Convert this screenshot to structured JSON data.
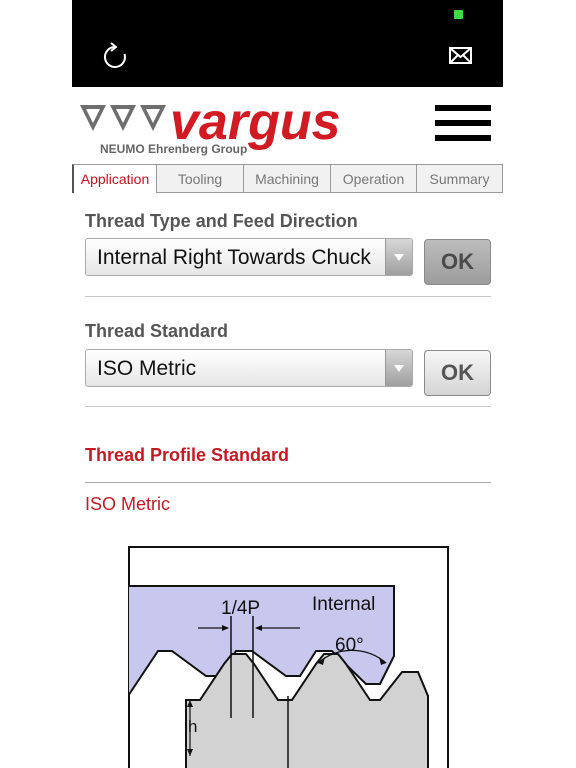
{
  "app": {
    "logo_text": "vargus",
    "logo_subtitle": "NEUMO Ehrenberg Group"
  },
  "tabs": [
    {
      "label": "Application",
      "active": true
    },
    {
      "label": "Tooling",
      "active": false
    },
    {
      "label": "Machining",
      "active": false
    },
    {
      "label": "Operation",
      "active": false
    },
    {
      "label": "Summary",
      "active": false
    }
  ],
  "thread_type": {
    "title": "Thread Type and Feed Direction",
    "selected": "Internal Right Towards Chuck",
    "ok_label": "OK"
  },
  "thread_standard": {
    "title": "Thread Standard",
    "selected": "ISO Metric",
    "ok_label": "OK"
  },
  "profile": {
    "title": "Thread Profile Standard",
    "value": "ISO Metric"
  },
  "diagram": {
    "label_pitch": "1/4P",
    "label_internal": "Internal",
    "label_angle": "60°",
    "label_height": "h"
  },
  "colors": {
    "accent_red": "#c41a22",
    "status_green": "#3ddc47",
    "profile_fill": "#c8c8ee"
  },
  "icons": {
    "refresh": "refresh-icon",
    "mail": "mail-icon",
    "menu": "hamburger-menu-icon"
  }
}
